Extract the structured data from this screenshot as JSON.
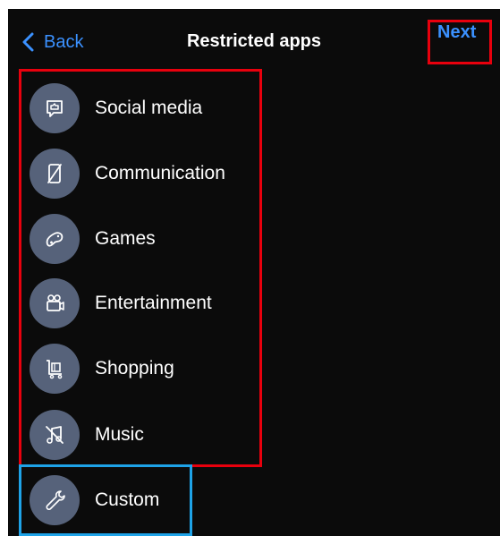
{
  "nav": {
    "back_label": "Back",
    "title": "Restricted apps",
    "next_label": "Next"
  },
  "categories": [
    {
      "label": "Social media",
      "icon": "chat-bubble-icon"
    },
    {
      "label": "Communication",
      "icon": "phone-off-icon"
    },
    {
      "label": "Games",
      "icon": "game-controller-icon"
    },
    {
      "label": "Entertainment",
      "icon": "video-camera-icon"
    },
    {
      "label": "Shopping",
      "icon": "shopping-cart-icon"
    },
    {
      "label": "Music",
      "icon": "music-off-icon"
    }
  ],
  "custom": {
    "label": "Custom",
    "icon": "wrench-icon"
  },
  "colors": {
    "background": "#0b0b0b",
    "accent": "#3b91ff",
    "icon_circle": "#56627a",
    "highlight_red": "#e8000d",
    "highlight_blue": "#1ea3e8"
  }
}
